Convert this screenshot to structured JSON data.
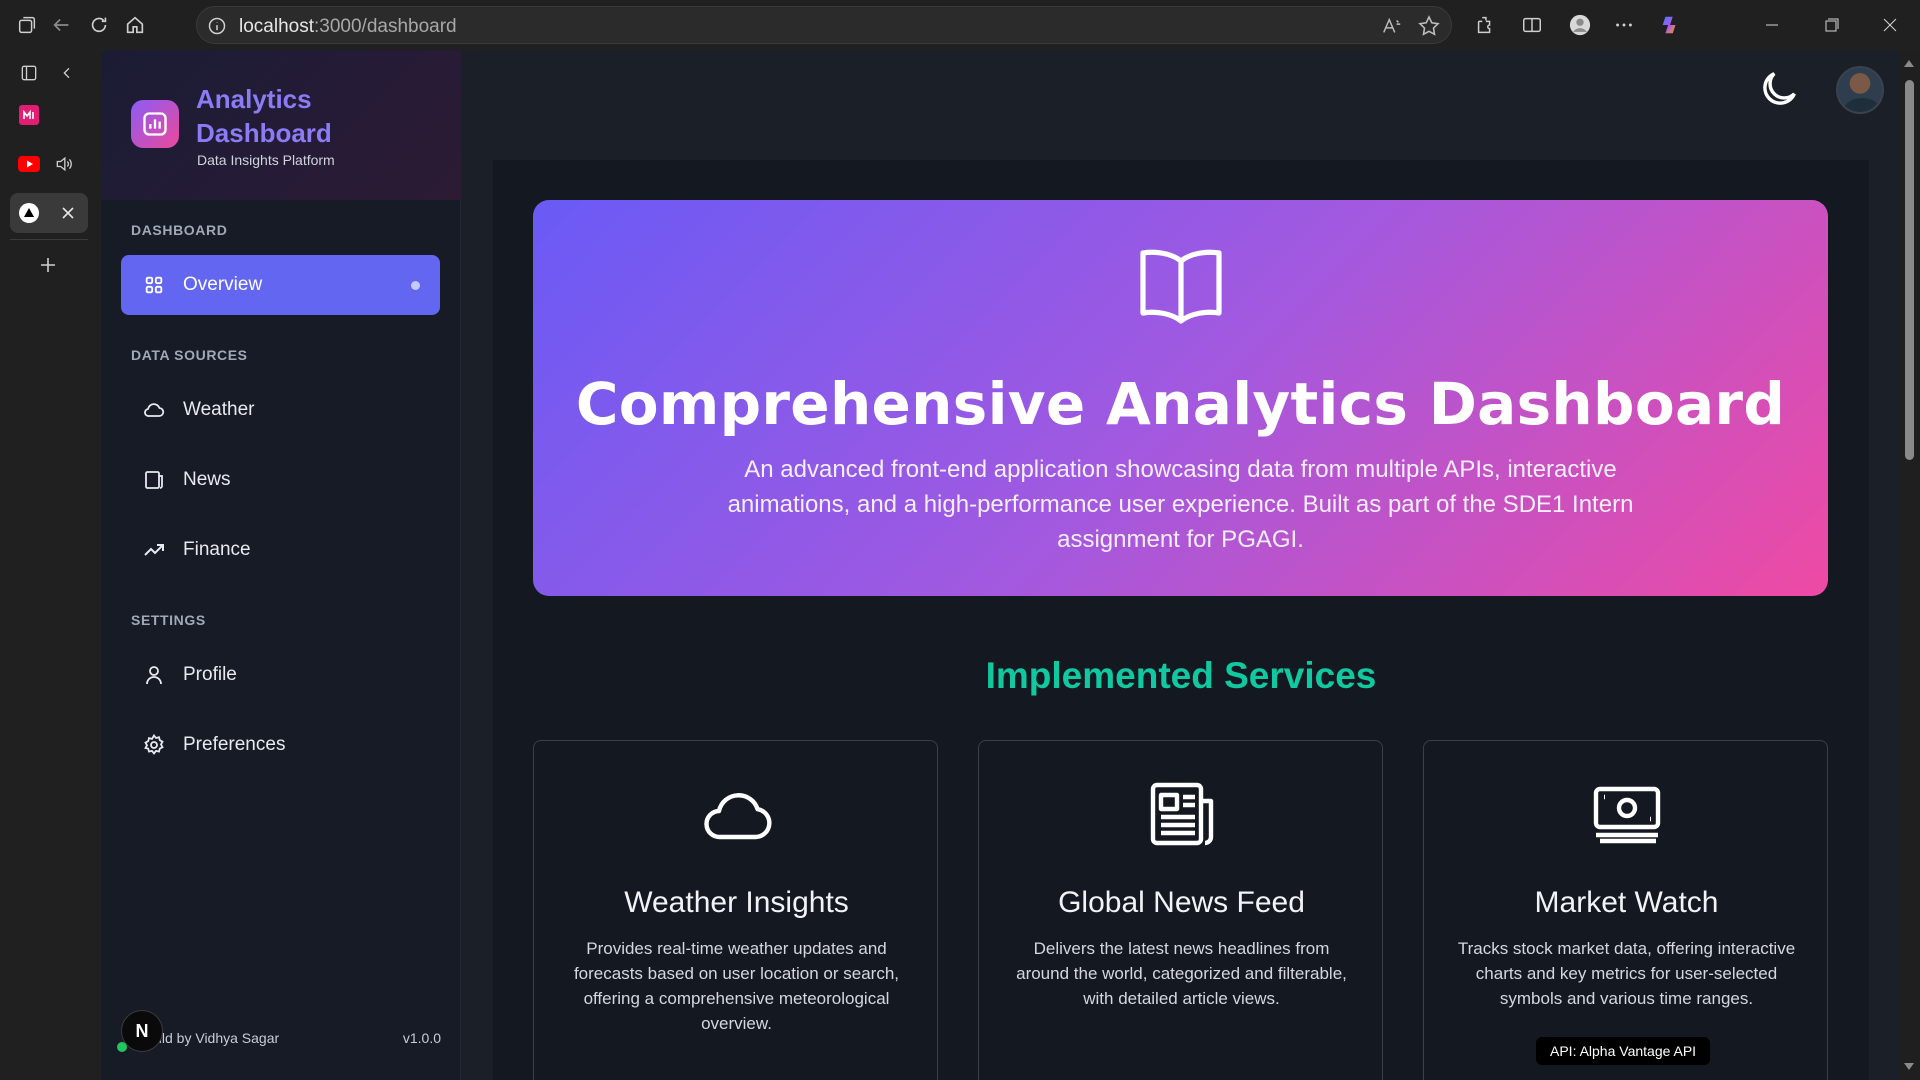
{
  "browser": {
    "url_host": "localhost",
    "url_path": ":3000/dashboard"
  },
  "sidebar": {
    "brand_title": "Analytics Dashboard",
    "brand_subtitle": "Data Insights Platform",
    "sections": [
      {
        "label": "DASHBOARD"
      },
      {
        "label": "DATA SOURCES"
      },
      {
        "label": "SETTINGS"
      }
    ],
    "items": [
      {
        "label": "Overview",
        "icon": "grid-icon",
        "active": true
      },
      {
        "label": "Weather",
        "icon": "cloud-icon"
      },
      {
        "label": "News",
        "icon": "newspaper-icon"
      },
      {
        "label": "Finance",
        "icon": "trending-up-icon"
      },
      {
        "label": "Profile",
        "icon": "user-icon"
      },
      {
        "label": "Preferences",
        "icon": "gear-icon"
      }
    ],
    "footer_build": "uild by Vidhya Sagar",
    "footer_version": "v1.0.0",
    "footer_badge": "N"
  },
  "hero": {
    "title": "Comprehensive Analytics Dashboard",
    "description": "An advanced front-end application showcasing data from multiple APIs, interactive animations, and a high-performance user experience. Built as part of the SDE1 Intern assignment for PGAGI."
  },
  "services": {
    "title": "Implemented Services",
    "cards": [
      {
        "icon": "cloud-icon",
        "title": "Weather Insights",
        "description": "Provides real-time weather updates and forecasts based on user location or search, offering a comprehensive meteorological overview."
      },
      {
        "icon": "newspaper-icon",
        "title": "Global News Feed",
        "description": "Delivers the latest news headlines from around the world, categorized and filterable, with detailed article views."
      },
      {
        "icon": "cash-icon",
        "title": "Market Watch",
        "description": "Tracks stock market data, offering interactive charts and key metrics for user-selected symbols and various time ranges.",
        "api": "API: Alpha Vantage API"
      }
    ]
  },
  "colors": {
    "accent": "#6366f1",
    "services_title": "#10c9a0",
    "hero_gradient_start": "#6a5af5",
    "hero_gradient_end": "#ee4aa3"
  }
}
